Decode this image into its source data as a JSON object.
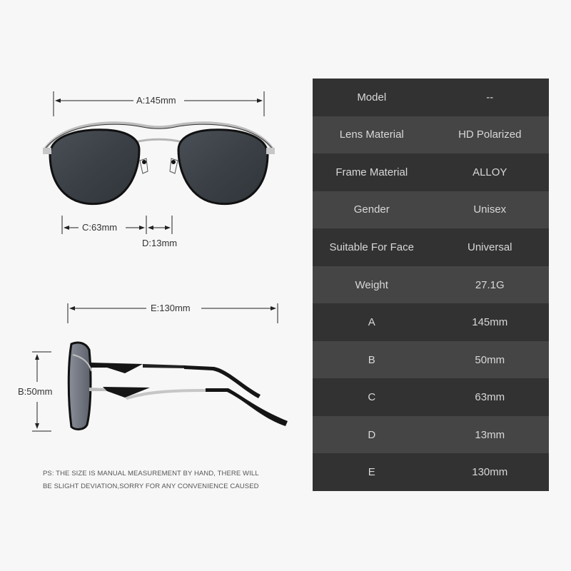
{
  "dimensions": {
    "a": "A:145mm",
    "c": "C:63mm",
    "d": "D:13mm",
    "e": "E:130mm",
    "b": "B:50mm"
  },
  "note": {
    "line1": "PS: THE SIZE IS MANUAL MEASUREMENT BY HAND, THERE WILL",
    "line2": "BE SLIGHT DEVIATION,SORRY FOR ANY CONVENIENCE CAUSED"
  },
  "specs": [
    {
      "label": "Model",
      "value": "--"
    },
    {
      "label": "Lens Material",
      "value": "HD Polarized"
    },
    {
      "label": "Frame Material",
      "value": "ALLOY"
    },
    {
      "label": "Gender",
      "value": "Unisex"
    },
    {
      "label": "Suitable For Face",
      "value": "Universal"
    },
    {
      "label": "Weight",
      "value": "27.1G"
    },
    {
      "label": "A",
      "value": "145mm"
    },
    {
      "label": "B",
      "value": "50mm"
    },
    {
      "label": "C",
      "value": "63mm"
    },
    {
      "label": "D",
      "value": "13mm"
    },
    {
      "label": "E",
      "value": "130mm"
    }
  ],
  "colors": {
    "row_dark": "#323232",
    "row_light": "#454545",
    "background": "#f7f7f7"
  }
}
